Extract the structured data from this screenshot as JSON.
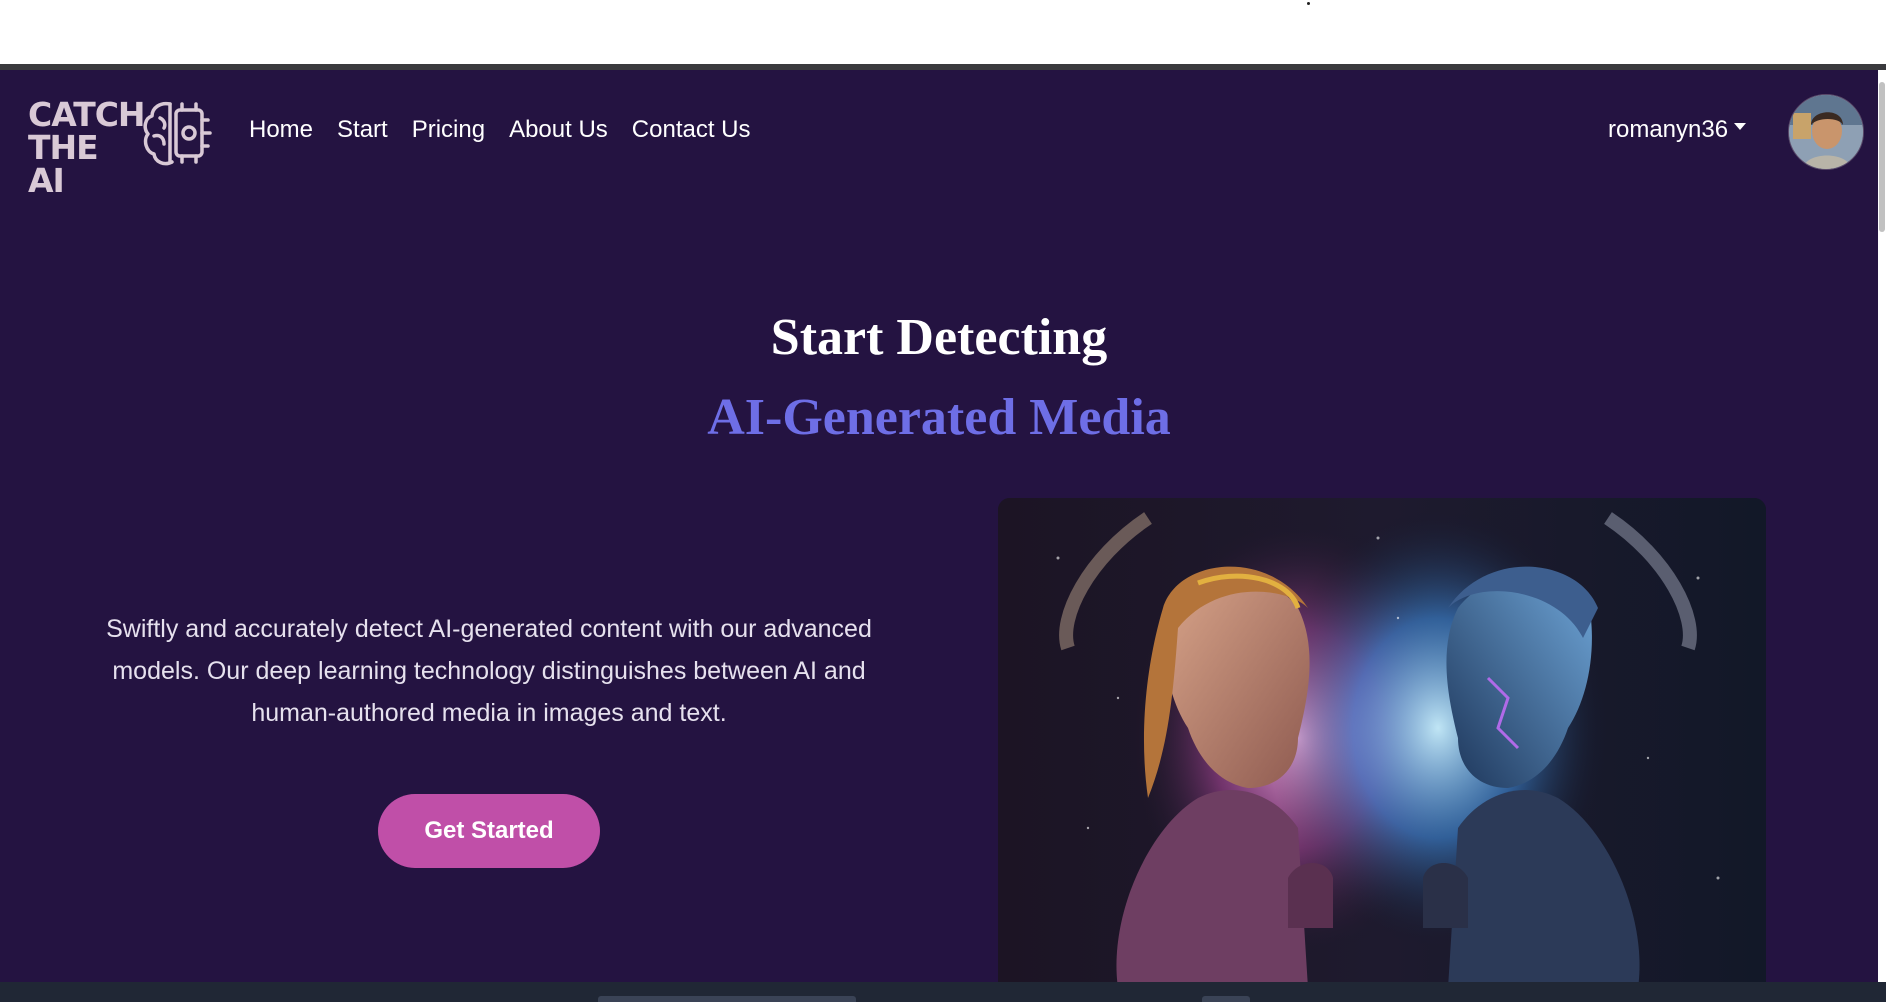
{
  "logo": {
    "line1": "CATCH",
    "line2": "THE AI",
    "icon": "brain-chip-icon"
  },
  "nav": {
    "links": [
      "Home",
      "Start",
      "Pricing",
      "About Us",
      "Contact Us"
    ]
  },
  "user": {
    "username": "romanyn36",
    "avatar": "user-avatar"
  },
  "hero": {
    "title": "Start Detecting",
    "subtitle": "AI-Generated Media",
    "description": "Swiftly and accurately detect AI-generated content with our advanced models. Our deep learning technology distinguishes between AI and human-authored media in images and text.",
    "cta_label": "Get Started",
    "image": "human-vs-robot-face-off-illustration"
  },
  "colors": {
    "background": "#241341",
    "accent": "#6e6ee6",
    "button": "#c04fa8",
    "logo": "#d9c9d6"
  }
}
